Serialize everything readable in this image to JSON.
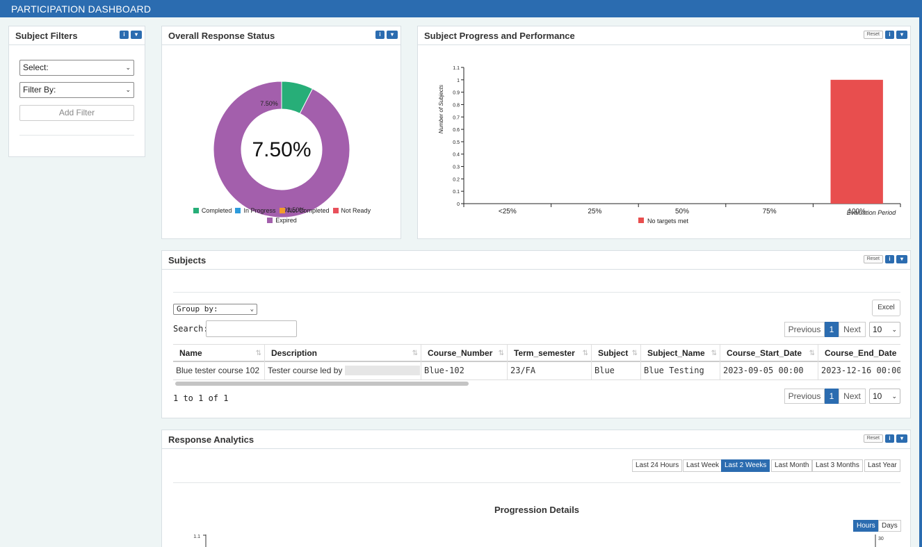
{
  "app": {
    "title": "PARTICIPATION DASHBOARD"
  },
  "filters": {
    "title": "Subject Filters",
    "select_value": "Select:",
    "filter_by_value": "Filter By:",
    "add_filter_label": "Add Filter"
  },
  "response_status": {
    "title": "Overall Response Status",
    "center_label": "7.50%",
    "completed_label": "7.50%",
    "expired_label": "92.50%"
  },
  "progress": {
    "title": "Subject Progress and Performance",
    "reset_label": "Reset"
  },
  "subjects": {
    "title": "Subjects",
    "reset_label": "Reset",
    "group_by_value": "Group by:",
    "excel_label": "Excel",
    "search_label": "Search:",
    "search_value": "",
    "pager": {
      "previous": "Previous",
      "page": "1",
      "next": "Next",
      "per_page": "10"
    },
    "info": "1 to 1 of 1",
    "columns": [
      "Name",
      "Description",
      "Course_Number",
      "Term_semester",
      "Subject",
      "Subject_Name",
      "Course_Start_Date",
      "Course_End_Date"
    ],
    "rows": [
      [
        "Blue tester course 102",
        "Tester course led by",
        "Blue-102",
        "23/FA",
        "Blue",
        "Blue Testing",
        "2023-09-05 00:00",
        "2023-12-16 00:00"
      ]
    ]
  },
  "analytics": {
    "title": "Response Analytics",
    "reset_label": "Reset",
    "ranges": [
      "Last 24 Hours",
      "Last Week",
      "Last 2 Weeks",
      "Last Month",
      "Last 3 Months",
      "Last Year"
    ],
    "active_range": "Last 2 Weeks",
    "chart_title": "Progression Details",
    "units": [
      "Hours",
      "Days"
    ],
    "active_unit": "Hours",
    "left_tick": "1.1",
    "right_tick": "30"
  },
  "chart_data": [
    {
      "type": "pie",
      "variant": "donut",
      "categories": [
        "Completed",
        "In Progress",
        "Not Completed",
        "Not Ready",
        "Expired"
      ],
      "values": [
        7.5,
        0,
        0,
        0,
        92.5
      ],
      "colors": [
        "#27ae78",
        "#2d9bdc",
        "#f39c2b",
        "#e8505b",
        "#a35fac"
      ],
      "legend_position": "bottom"
    },
    {
      "type": "bar",
      "categories": [
        "<25%",
        "25%",
        "50%",
        "75%",
        "100%"
      ],
      "series": [
        {
          "name": "No targets met",
          "values": [
            0,
            0,
            0,
            0,
            1
          ],
          "color": "#e84e4e"
        }
      ],
      "ylabel": "Number of Subjects",
      "xlabel": "Evaluation Period",
      "ylim": [
        0,
        1.1
      ],
      "yticks": [
        "0",
        "0.1",
        "0.2",
        "0.3",
        "0.4",
        "0.5",
        "0.6",
        "0.7",
        "0.8",
        "0.9",
        "1",
        "1.1"
      ],
      "legend_position": "bottom"
    }
  ]
}
